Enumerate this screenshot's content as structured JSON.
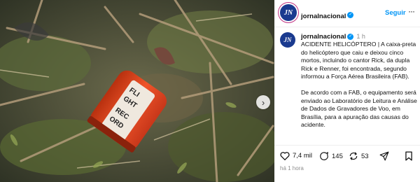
{
  "post": {
    "media": {
      "description_icon": "photo",
      "next_icon": "chevron-right-icon"
    },
    "header": {
      "avatar_text": "JN",
      "username": "jornalnacional",
      "follow_label": "Seguir",
      "more_label": "···"
    },
    "caption": {
      "avatar_text": "JN",
      "username": "jornalnacional",
      "time": "1 h",
      "text": "ACIDENTE HELICÓPTERO | A caixa-preta do helicóptero que caiu e deixou cinco mortos, incluindo o cantor Rick, da dupla Rick e Renner, foi encontrada, segundo informou a Força Aérea Brasileira (FAB).\n\nDe acordo com a FAB, o equipamento será enviado ao Laboratório de Leitura e Análise de Dados de Gravadores de Voo, em Brasília, para a apuração das causas do acidente."
    },
    "actions": {
      "likes": "7,4 mil",
      "comments": "145",
      "shares": "53"
    },
    "posted_ago": "há 1 hora",
    "colors": {
      "brand_blue": "#1a3a8f",
      "follow_blue": "#0095f6",
      "recorder_orange": "#e8431c"
    }
  }
}
